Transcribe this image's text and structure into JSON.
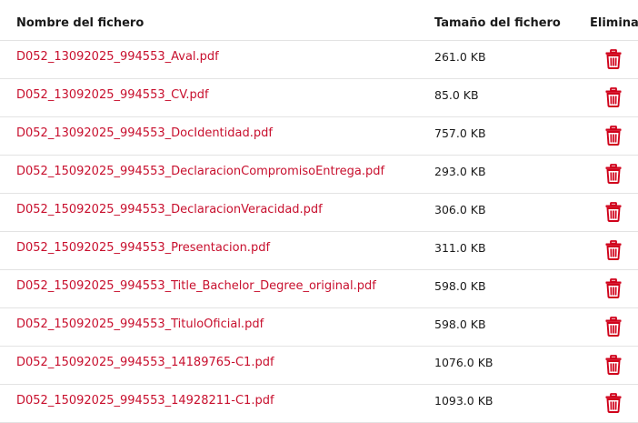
{
  "header": {
    "name": "Nombre del fichero",
    "size": "Tamaño del fichero",
    "delete": "Eliminar"
  },
  "colors": {
    "link": "#c8102e",
    "trash": "#d0021b"
  },
  "files": [
    {
      "name": "D052_13092025_994553_Aval.pdf",
      "size": "261.0 KB"
    },
    {
      "name": "D052_13092025_994553_CV.pdf",
      "size": "85.0 KB"
    },
    {
      "name": "D052_13092025_994553_DocIdentidad.pdf",
      "size": "757.0 KB"
    },
    {
      "name": "D052_15092025_994553_DeclaracionCompromisoEntrega.pdf",
      "size": "293.0 KB"
    },
    {
      "name": "D052_15092025_994553_DeclaracionVeracidad.pdf",
      "size": "306.0 KB"
    },
    {
      "name": "D052_15092025_994553_Presentacion.pdf",
      "size": "311.0 KB"
    },
    {
      "name": "D052_15092025_994553_Title_Bachelor_Degree_original.pdf",
      "size": "598.0 KB"
    },
    {
      "name": "D052_15092025_994553_TituloOficial.pdf",
      "size": "598.0 KB"
    },
    {
      "name": "D052_15092025_994553_14189765-C1.pdf",
      "size": "1076.0 KB"
    },
    {
      "name": "D052_15092025_994553_14928211-C1.pdf",
      "size": "1093.0 KB"
    }
  ]
}
